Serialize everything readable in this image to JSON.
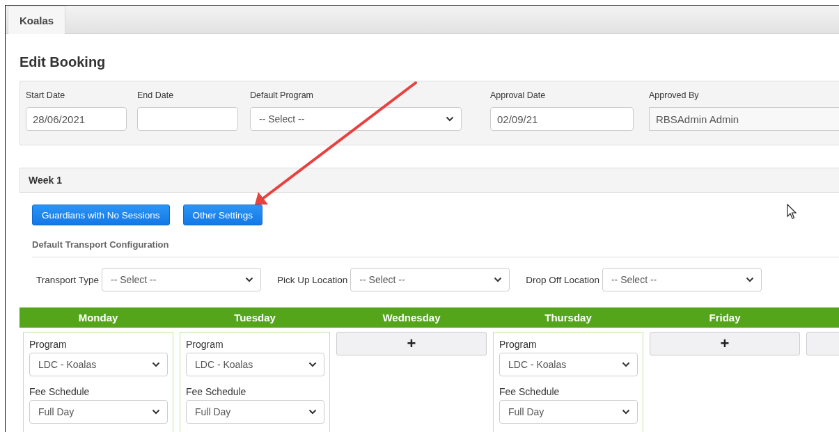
{
  "tabs": [
    {
      "label": "Koalas",
      "selected": true
    }
  ],
  "title": "Edit Booking",
  "booking_fields": [
    {
      "label": "Start Date",
      "kind": "input",
      "value": "28/06/2021"
    },
    {
      "label": "End Date",
      "kind": "input"
    },
    {
      "label": "Default Program",
      "kind": "select",
      "value": "-- Select --"
    },
    {
      "label": "Approval Date",
      "kind": "input",
      "value": "02/09/21"
    },
    {
      "label": "Approved By",
      "kind": "readonly",
      "value": "RBSAdmin Admin"
    }
  ],
  "week": {
    "title": "Week 1",
    "buttons": [
      "Guardians with No Sessions",
      "Other Settings"
    ],
    "transport_heading": "Default Transport Configuration",
    "transport_fields": [
      {
        "label": "Transport Type",
        "value": "-- Select --"
      },
      {
        "label": "Pick Up Location",
        "value": "-- Select --"
      },
      {
        "label": "Drop Off Location",
        "value": "-- Select --"
      }
    ],
    "days": [
      {
        "name": "Monday",
        "kind": "session",
        "fields": [
          {
            "label": "Program",
            "value": "LDC - Koalas"
          },
          {
            "label": "Fee Schedule",
            "value": "Full Day"
          }
        ]
      },
      {
        "name": "Tuesday",
        "kind": "session",
        "fields": [
          {
            "label": "Program",
            "value": "LDC - Koalas"
          },
          {
            "label": "Fee Schedule",
            "value": "Full Day"
          }
        ]
      },
      {
        "name": "Wednesday",
        "kind": "add",
        "add_label": "+"
      },
      {
        "name": "Thursday",
        "kind": "session",
        "fields": [
          {
            "label": "Program",
            "value": "LDC - Koalas"
          },
          {
            "label": "Fee Schedule",
            "value": "Full Day"
          }
        ]
      },
      {
        "name": "Friday",
        "kind": "add",
        "add_label": "+"
      },
      {
        "kind": "add"
      }
    ]
  }
}
